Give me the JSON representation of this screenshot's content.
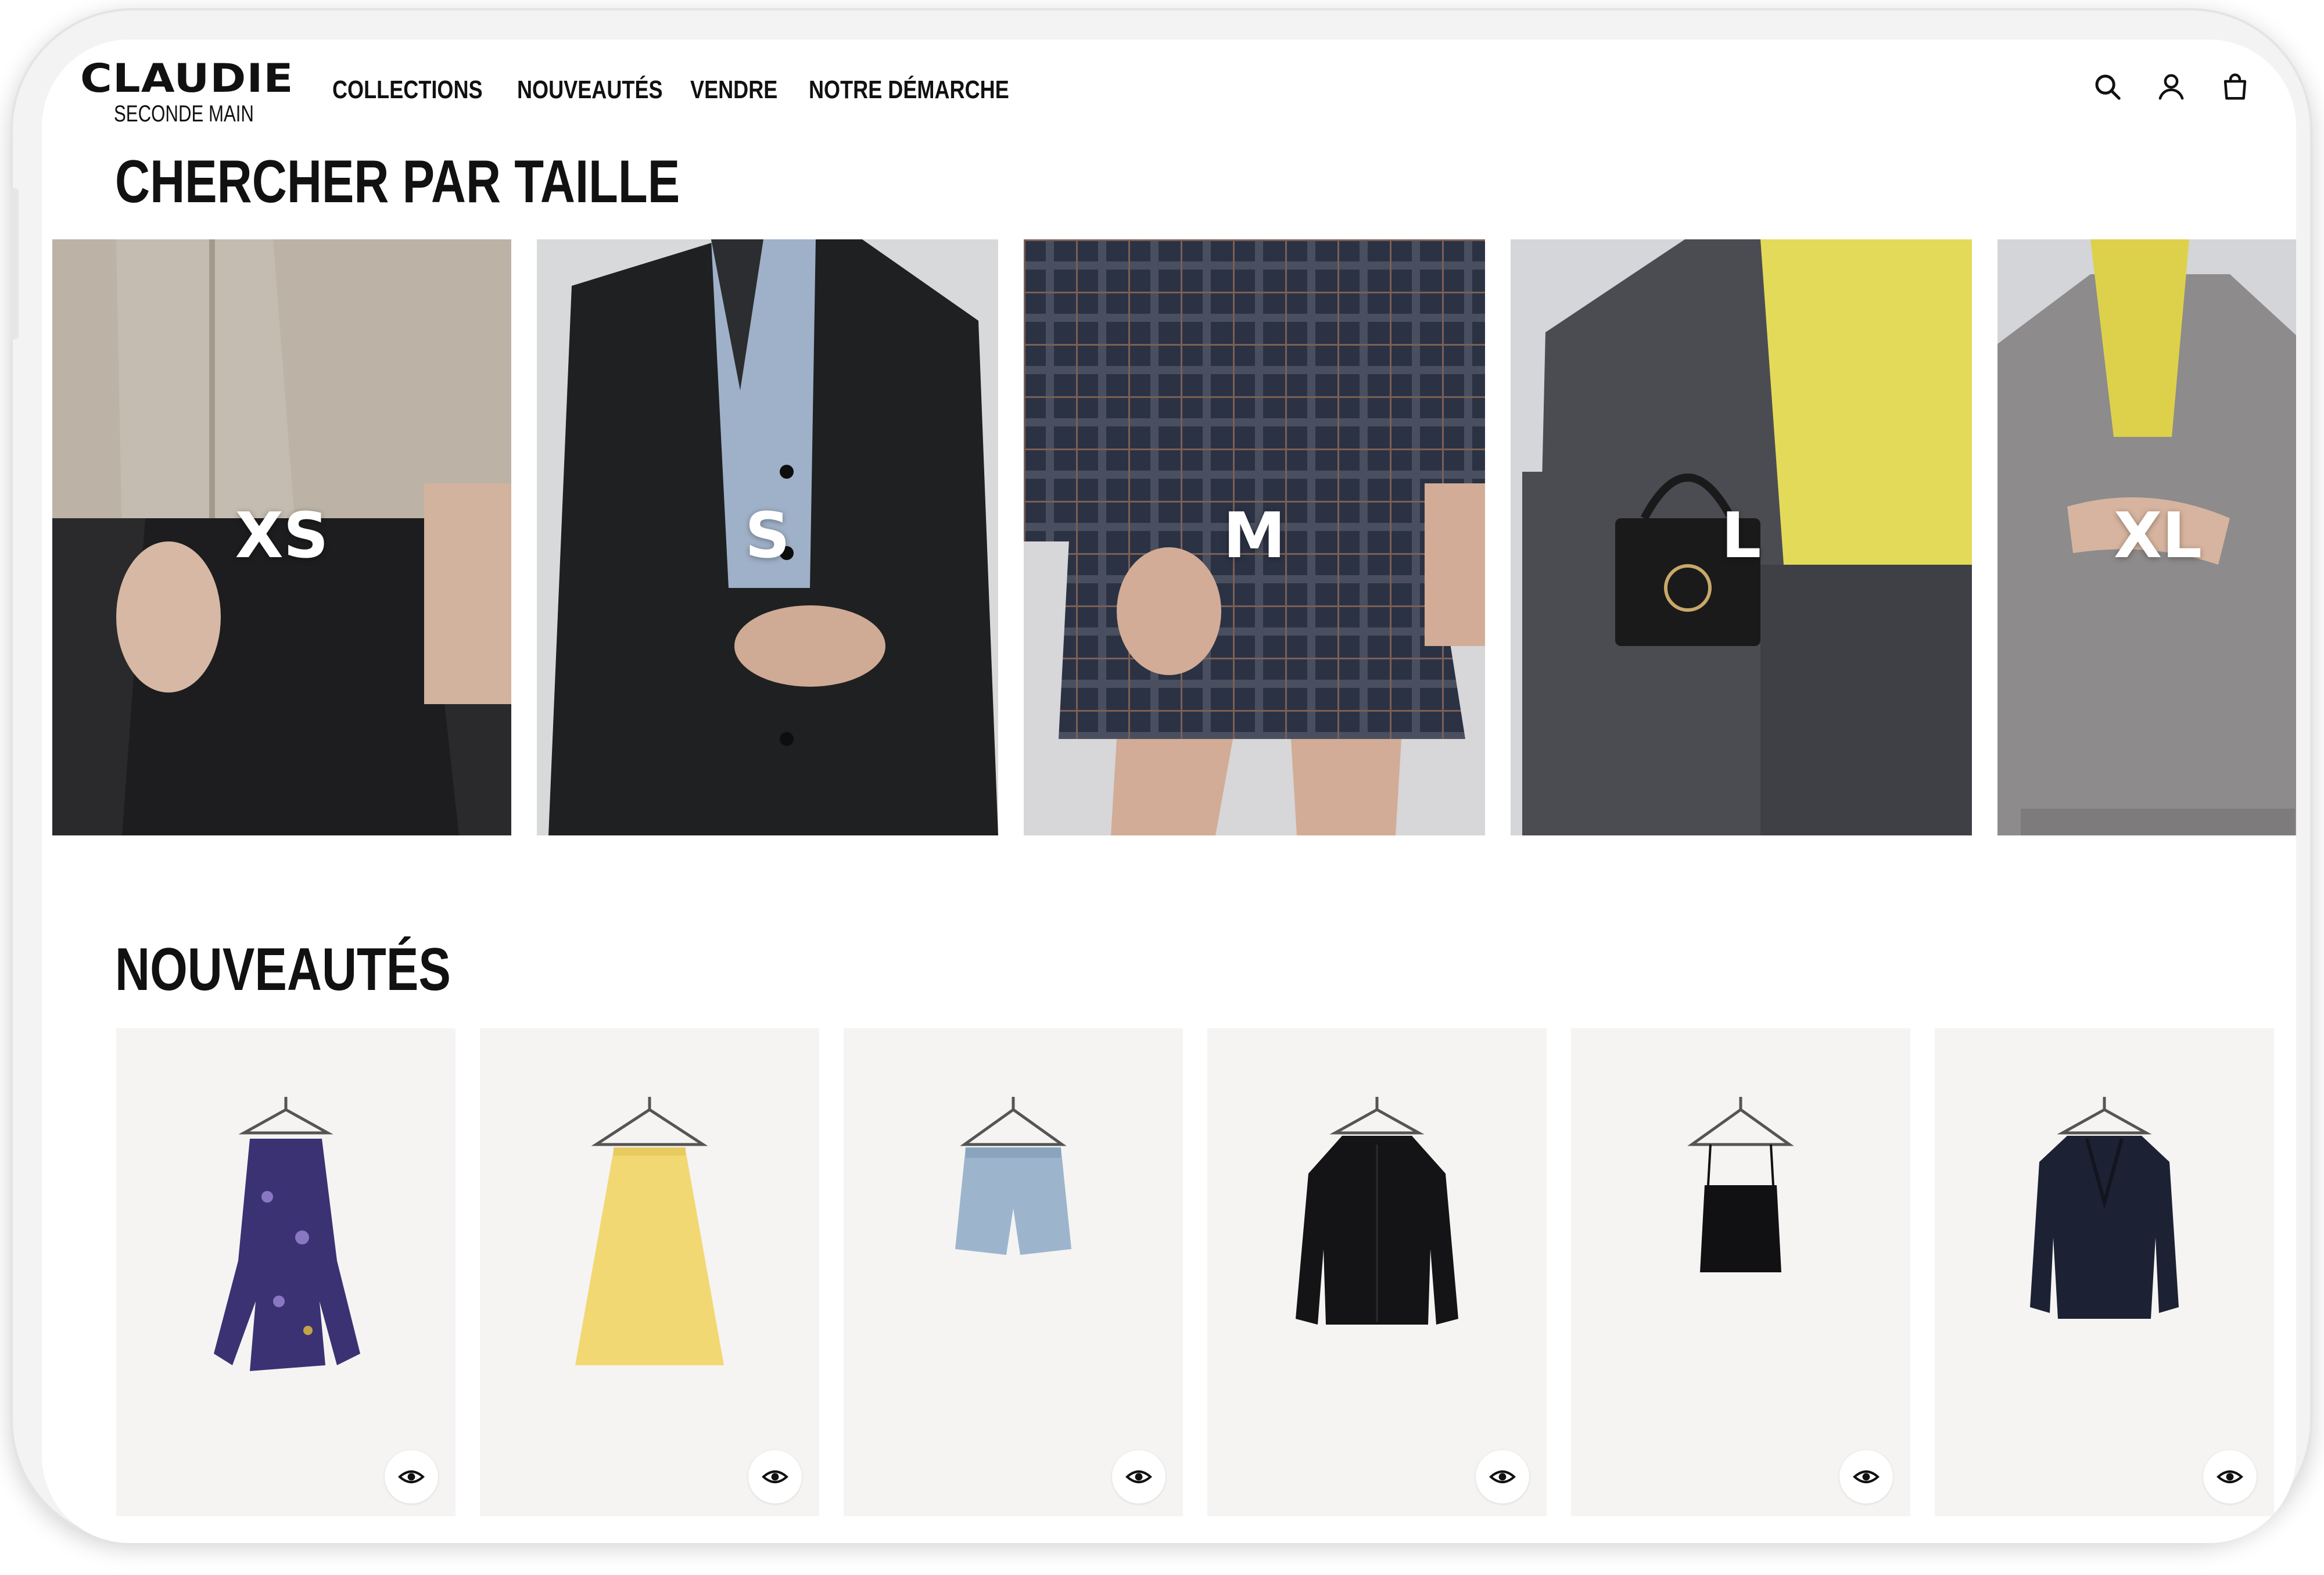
{
  "brand": {
    "name": "CLAUDIE",
    "tagline": "SECONDE MAIN"
  },
  "nav": {
    "items": [
      "COLLECTIONS",
      "NOUVEAUTÉS",
      "VENDRE",
      "NOTRE DÉMARCHE"
    ]
  },
  "header_icons": [
    "search-icon",
    "account-icon",
    "shopping-bag-icon"
  ],
  "size_section": {
    "title": "CHERCHER PAR TAILLE",
    "sizes": [
      "XS",
      "S",
      "M",
      "L",
      "XL"
    ]
  },
  "new_section": {
    "title": "NOUVEAUTÉS",
    "products": [
      {
        "item": "robe",
        "icon": "eye-icon"
      },
      {
        "item": "jupe",
        "icon": "eye-icon"
      },
      {
        "item": "short",
        "icon": "eye-icon"
      },
      {
        "item": "cardigan",
        "icon": "eye-icon"
      },
      {
        "item": "débardeur",
        "icon": "eye-icon"
      },
      {
        "item": "blazer",
        "icon": "eye-icon"
      }
    ]
  },
  "colors": {
    "text": "#111111",
    "card_bg": "#f5f4f3",
    "frame": "#f3f3f4"
  }
}
